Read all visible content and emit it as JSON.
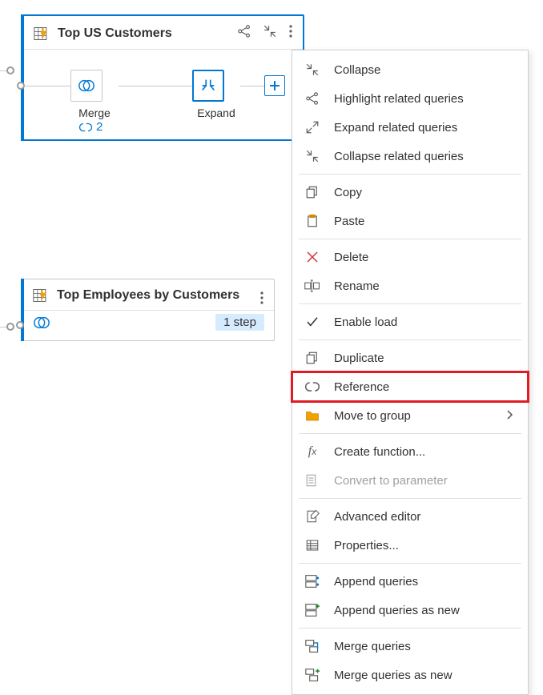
{
  "cards": {
    "c1": {
      "title": "Top US Customers",
      "steps": {
        "merge": "Merge",
        "expand": "Expand"
      },
      "link_count": "2"
    },
    "c2": {
      "title": "Top Employees by Customers",
      "badge": "1 step"
    }
  },
  "menu": {
    "collapse": "Collapse",
    "highlight_related": "Highlight related queries",
    "expand_related": "Expand related queries",
    "collapse_related": "Collapse related queries",
    "copy": "Copy",
    "paste": "Paste",
    "delete": "Delete",
    "rename": "Rename",
    "enable_load": "Enable load",
    "duplicate": "Duplicate",
    "reference": "Reference",
    "move_to_group": "Move to group",
    "create_function": "Create function...",
    "convert_to_parameter": "Convert to parameter",
    "advanced_editor": "Advanced editor",
    "properties": "Properties...",
    "append_queries": "Append queries",
    "append_queries_new": "Append queries as new",
    "merge_queries": "Merge queries",
    "merge_queries_new": "Merge queries as new"
  }
}
